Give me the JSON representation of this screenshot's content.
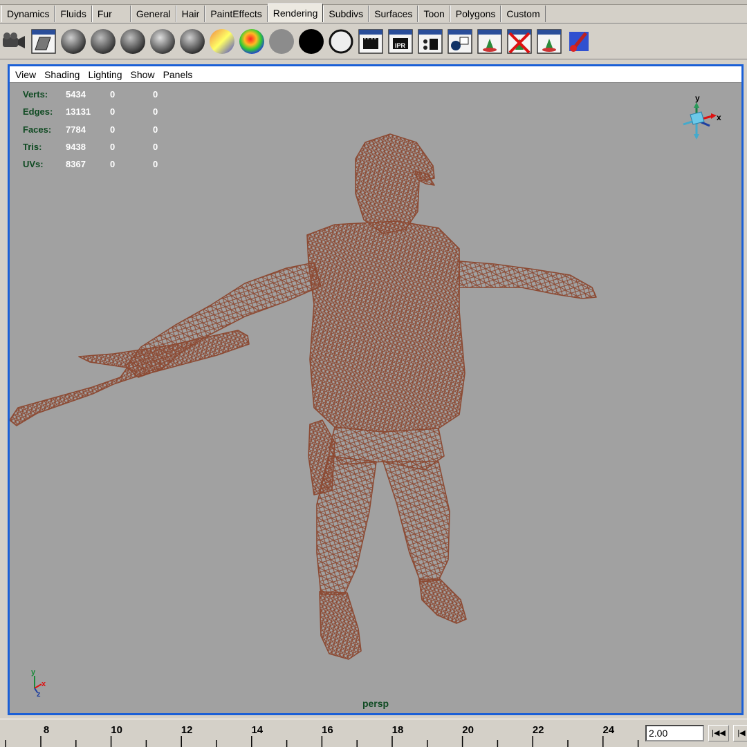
{
  "shelf_tabs": [
    "Dynamics",
    "Fluids",
    "Fur",
    "General",
    "Hair",
    "PaintEffects",
    "Rendering",
    "Subdivs",
    "Surfaces",
    "Toon",
    "Polygons",
    "Custom"
  ],
  "active_tab": "Rendering",
  "shelf_icons": [
    "render-camera-icon",
    "hypershade-icon",
    "lambert-shader-icon",
    "blinn-shader-icon",
    "phong-shader-icon",
    "phong-e-shader-icon",
    "anisotropic-shader-icon",
    "layered-shader-icon",
    "ramp-shader-icon",
    "surface-shader-icon",
    "use-background-icon",
    "shading-map-icon",
    "render-current-frame-icon",
    "ipr-render-icon",
    "render-globals-icon",
    "render-view-icon",
    "light-linking-icon",
    "break-light-links-icon",
    "make-light-links-icon",
    "paint-effects-icon"
  ],
  "panel_menu": [
    "View",
    "Shading",
    "Lighting",
    "Show",
    "Panels"
  ],
  "hud": [
    {
      "label": "Verts:",
      "v1": "5434",
      "v2": "0",
      "v3": "0"
    },
    {
      "label": "Edges:",
      "v1": "13131",
      "v2": "0",
      "v3": "0"
    },
    {
      "label": "Faces:",
      "v1": "7784",
      "v2": "0",
      "v3": "0"
    },
    {
      "label": "Tris:",
      "v1": "9438",
      "v2": "0",
      "v3": "0"
    },
    {
      "label": "UVs:",
      "v1": "8367",
      "v2": "0",
      "v3": "0"
    }
  ],
  "camera_name": "persp",
  "view_cube": {
    "y_label": "y",
    "x_label": "x"
  },
  "axis_gizmo": {
    "y_label": "y",
    "x_label": "x",
    "z_label": "z"
  },
  "timeline": {
    "labels": [
      "8",
      "10",
      "12",
      "14",
      "16",
      "18",
      "20",
      "22",
      "24"
    ],
    "current_frame": "2.00"
  },
  "playback_buttons": {
    "rewind": "|◀◀",
    "step_back": "|◀"
  },
  "colors": {
    "viewport_bg": "#a1a1a1",
    "wireframe": "#8c4a33",
    "active_border": "#1a5fd6",
    "hud_label": "#0f4a22",
    "hud_value": "#ffffff"
  }
}
